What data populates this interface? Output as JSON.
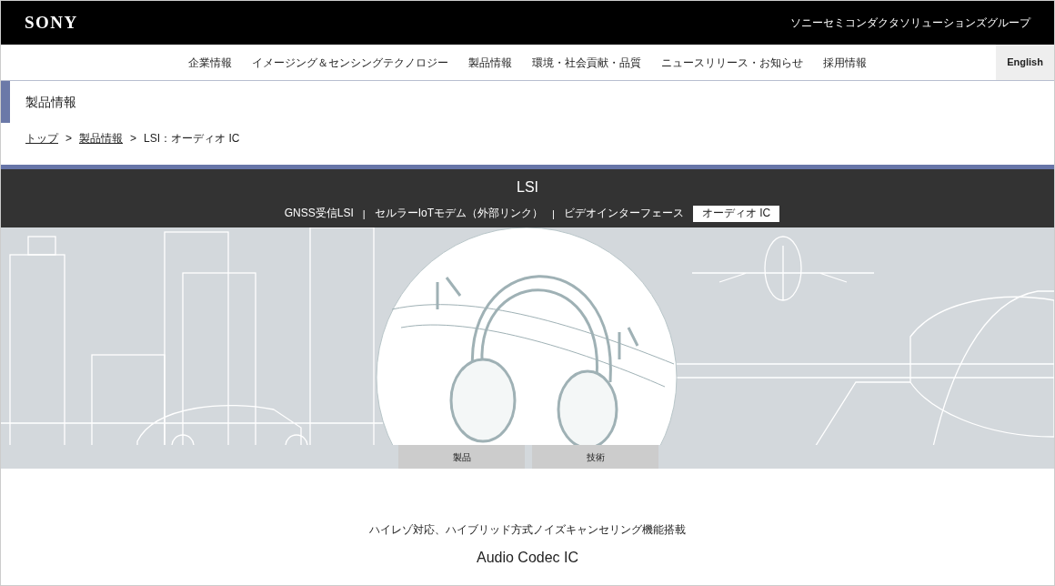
{
  "header": {
    "logo": "SONY",
    "group_name": "ソニーセミコンダクタソリューションズグループ"
  },
  "nav": {
    "items": [
      "企業情報",
      "イメージング＆センシングテクノロジー",
      "製品情報",
      "環境・社会貢献・品質",
      "ニュースリリース・お知らせ",
      "採用情報"
    ],
    "language": "English"
  },
  "page_title": "製品情報",
  "breadcrumb": {
    "separator": ">",
    "links": [
      "トップ",
      "製品情報"
    ],
    "current": "LSI：オーディオ IC"
  },
  "category": {
    "title": "LSI",
    "separator": "|",
    "tabs": [
      {
        "label": "GNSS受信LSI",
        "selected": false
      },
      {
        "label": "セルラーIoTモデム（外部リンク）",
        "selected": false
      },
      {
        "label": "ビデオインターフェース",
        "selected": false
      },
      {
        "label": "オーディオ IC",
        "selected": true
      }
    ]
  },
  "hero_buttons": [
    "製品",
    "技術"
  ],
  "tagline": "ハイレゾ対応、ハイブリッド方式ノイズキャンセリング機能搭載",
  "product_title": "Audio Codec IC"
}
